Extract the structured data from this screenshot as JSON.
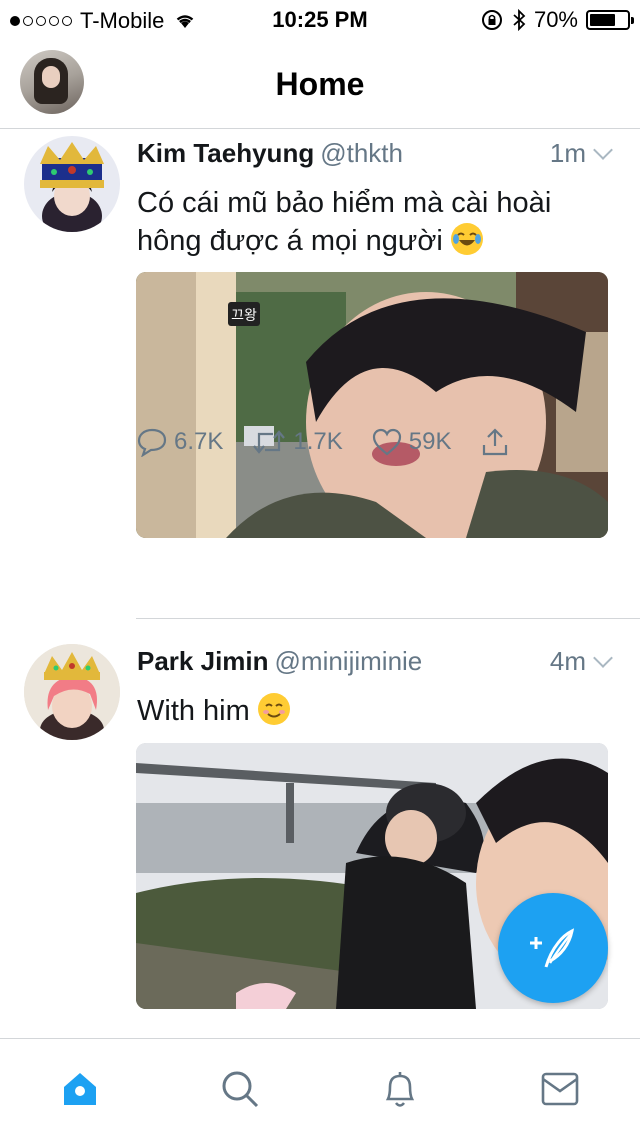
{
  "status_bar": {
    "carrier": "T-Mobile",
    "time": "10:25 PM",
    "battery": "70%",
    "signal_bars_filled": 1,
    "signal_bars_total": 5,
    "battery_level": 0.7
  },
  "header": {
    "title": "Home"
  },
  "tweets": [
    {
      "name": "Kim Taehyung",
      "handle": "@thkth",
      "time": "1m",
      "text": "Có cái mũ bảo hiểm mà cài hoài hông được á mọi người",
      "emoji": "tears-of-joy-emoji",
      "media_caption": "끄왕",
      "replies": "6.7K",
      "retweets": "1.7K",
      "likes": "59K"
    },
    {
      "name": "Park Jimin",
      "handle": "@minijiminie",
      "time": "4m",
      "text": "With him",
      "emoji": "smiling-blush-emoji"
    }
  ],
  "icons": {
    "reply": "reply-icon",
    "retweet": "retweet-icon",
    "like": "heart-icon",
    "share": "share-icon",
    "compose": "compose-tweet-icon",
    "home": "home-icon",
    "search": "search-icon",
    "notifications": "bell-icon",
    "messages": "mail-icon"
  },
  "colors": {
    "accent": "#1da1f2",
    "text_primary": "#14171a",
    "text_secondary": "#657786",
    "divider": "#d3d6d9"
  }
}
